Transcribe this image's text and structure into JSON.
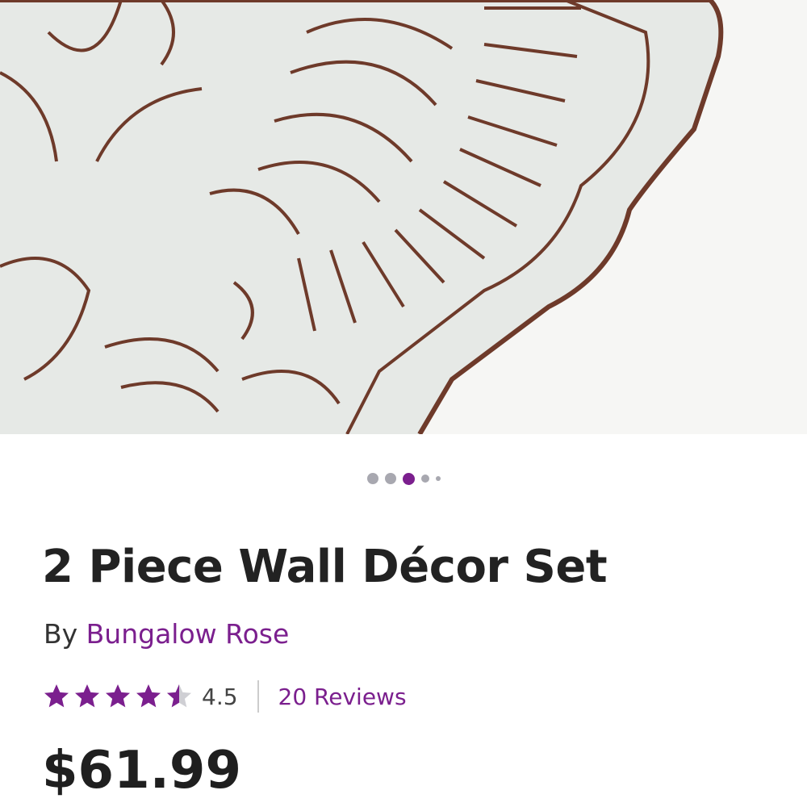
{
  "product": {
    "title": "2 Piece Wall Décor Set",
    "by_label": "By",
    "brand": "Bungalow Rose",
    "rating": "4.5",
    "rating_fraction": 0.9,
    "reviews_label": "20 Reviews",
    "price": "$61.99"
  },
  "carousel": {
    "dot_count": 5,
    "active_index": 2
  },
  "icons": {
    "star": "star-icon",
    "half_star": "half-star-icon"
  },
  "colors": {
    "accent": "#7b1f8e",
    "text": "#222222",
    "dot_inactive": "#a8a8b0"
  }
}
